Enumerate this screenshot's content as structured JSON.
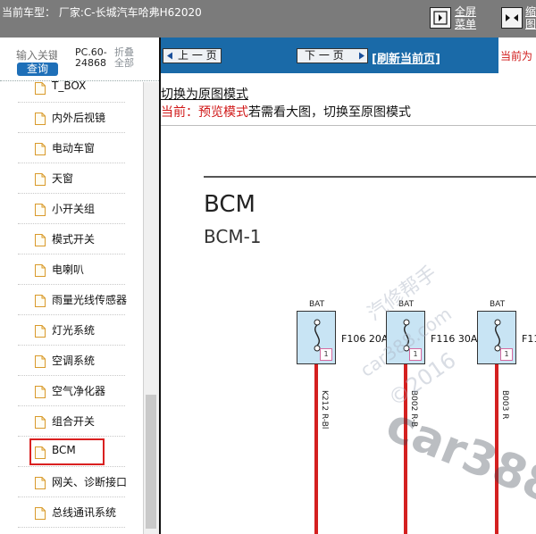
{
  "header": {
    "title": "当前车型：  厂家:C-长城汽车哈弗H62020",
    "fullscreen_label_1": "全屏",
    "fullscreen_label_2": "菜单",
    "shrink_label_1": "缩",
    "shrink_label_2": "图"
  },
  "sidebar": {
    "search_placeholder": "输入关键",
    "query_label": "查询",
    "pc_code_1": "PC.60-",
    "pc_code_2": "24868",
    "collapse_1": "折叠",
    "collapse_2": "全部",
    "items": [
      {
        "label": "T_BOX"
      },
      {
        "label": "内外后视镜"
      },
      {
        "label": "电动车窗"
      },
      {
        "label": "天窗"
      },
      {
        "label": "小开关组"
      },
      {
        "label": "模式开关"
      },
      {
        "label": "电喇叭"
      },
      {
        "label": "雨量光线传感器"
      },
      {
        "label": "灯光系统"
      },
      {
        "label": "空调系统"
      },
      {
        "label": "空气净化器"
      },
      {
        "label": "组合开关"
      },
      {
        "label": "BCM",
        "selected": true
      },
      {
        "label": "网关、诊断接口"
      },
      {
        "label": "总线通讯系统"
      }
    ]
  },
  "toolbar": {
    "prev_label": "上 一 页",
    "next_label": "下 一 页",
    "refresh_label": "[刷新当前页]",
    "current_label": "当前为"
  },
  "content": {
    "switch_link": "切换为原图模式",
    "mode_prefix": "当前：预览模式",
    "mode_suffix": "若需看大图，切换至原图模式"
  },
  "diagram": {
    "title": "BCM",
    "subtitle": "BCM-1",
    "fuses": [
      {
        "bat": "BAT",
        "label": "F106 20A",
        "num": "1",
        "wire": "K212 R-Bl"
      },
      {
        "bat": "BAT",
        "label": "F116 30A",
        "num": "1",
        "wire": "B002 R-B"
      },
      {
        "bat": "BAT",
        "label": "F11",
        "num": "1",
        "wire": "B003 R"
      }
    ]
  },
  "watermark": {
    "a": "汽修帮手",
    "b": "car388.com",
    "c": "©2016",
    "d": "car388"
  },
  "colors": {
    "header_bg": "#7b7b7b",
    "toolbar_bg": "#1a6aa8",
    "query_btn": "#1e6fb8",
    "alert_red": "#d01818",
    "wire_red": "#d42020",
    "fuse_fill": "#c8e4f4"
  }
}
